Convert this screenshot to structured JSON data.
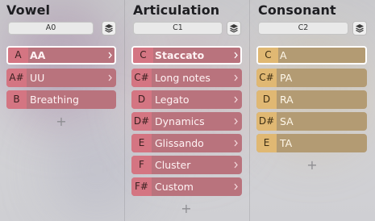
{
  "colors": {
    "vowel_accent": "#d47582",
    "articulation_accent": "#d47582",
    "consonant_accent": "#e0b873",
    "selected_border": "#ffffff"
  },
  "columns": [
    {
      "title": "Vowel",
      "range": "A0",
      "items": [
        {
          "note": "A",
          "label": "AA",
          "selected": true,
          "has_chevron": true
        },
        {
          "note": "A#",
          "label": "UU",
          "selected": false,
          "has_chevron": true
        },
        {
          "note": "B",
          "label": "Breathing",
          "selected": false,
          "has_chevron": false
        }
      ],
      "add_label": "+"
    },
    {
      "title": "Articulation",
      "range": "C1",
      "items": [
        {
          "note": "C",
          "label": "Staccato",
          "selected": true,
          "has_chevron": true
        },
        {
          "note": "C#",
          "label": "Long notes",
          "selected": false,
          "has_chevron": true
        },
        {
          "note": "D",
          "label": "Legato",
          "selected": false,
          "has_chevron": true
        },
        {
          "note": "D#",
          "label": "Dynamics",
          "selected": false,
          "has_chevron": true
        },
        {
          "note": "E",
          "label": "Glissando",
          "selected": false,
          "has_chevron": true
        },
        {
          "note": "F",
          "label": "Cluster",
          "selected": false,
          "has_chevron": true
        },
        {
          "note": "F#",
          "label": "Custom",
          "selected": false,
          "has_chevron": true
        }
      ],
      "add_label": "+"
    },
    {
      "title": "Consonant",
      "range": "C2",
      "items": [
        {
          "note": "C",
          "label": "A",
          "selected": true,
          "has_chevron": false
        },
        {
          "note": "C#",
          "label": "PA",
          "selected": false,
          "has_chevron": false
        },
        {
          "note": "D",
          "label": "RA",
          "selected": false,
          "has_chevron": false
        },
        {
          "note": "D#",
          "label": "SA",
          "selected": false,
          "has_chevron": false
        },
        {
          "note": "E",
          "label": "TA",
          "selected": false,
          "has_chevron": false
        }
      ],
      "add_label": "+"
    }
  ]
}
